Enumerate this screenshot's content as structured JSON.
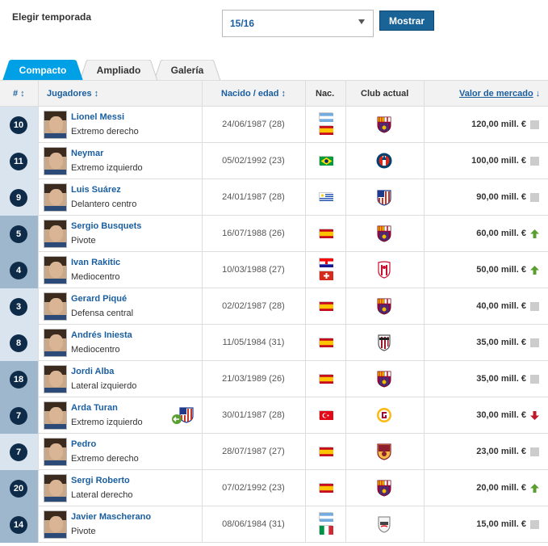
{
  "season": {
    "label": "Elegir temporada",
    "selected": "15/16",
    "button": "Mostrar"
  },
  "tabs": [
    {
      "label": "Compacto",
      "active": true
    },
    {
      "label": "Ampliado",
      "active": false
    },
    {
      "label": "Galería",
      "active": false
    }
  ],
  "header": {
    "num": "#",
    "players": "Jugadores",
    "born": "Nacido / edad",
    "nat": "Nac.",
    "club": "Club actual",
    "value": "Valor de mercado"
  },
  "rows": [
    {
      "num": "10",
      "name": "Lionel Messi",
      "position": "Extremo derecho",
      "born": "24/06/1987 (28)",
      "flags": [
        "argentina",
        "spain"
      ],
      "club": "barcelona",
      "value": "120,00 mill. €",
      "trend": "same"
    },
    {
      "num": "11",
      "name": "Neymar",
      "position": "Extremo izquierdo",
      "born": "05/02/1992 (23)",
      "flags": [
        "brazil"
      ],
      "club": "psg",
      "value": "100,00 mill. €",
      "trend": "same"
    },
    {
      "num": "9",
      "name": "Luis Suárez",
      "position": "Delantero centro",
      "born": "24/01/1987 (28)",
      "flags": [
        "uruguay"
      ],
      "club": "atletico",
      "value": "90,00 mill. €",
      "trend": "same"
    },
    {
      "num": "5",
      "name": "Sergio Busquets",
      "position": "Pivote",
      "born": "16/07/1988 (26)",
      "flags": [
        "spain"
      ],
      "club": "barcelona",
      "value": "60,00 mill. €",
      "trend": "up"
    },
    {
      "num": "4",
      "name": "Ivan Rakitic",
      "position": "Mediocentro",
      "born": "10/03/1988 (27)",
      "flags": [
        "croatia",
        "switzerland"
      ],
      "club": "sevilla",
      "value": "50,00 mill. €",
      "trend": "up"
    },
    {
      "num": "3",
      "name": "Gerard Piqué",
      "position": "Defensa central",
      "born": "02/02/1987 (28)",
      "flags": [
        "spain"
      ],
      "club": "barcelona",
      "value": "40,00 mill. €",
      "trend": "same"
    },
    {
      "num": "8",
      "name": "Andrés Iniesta",
      "position": "Mediocentro",
      "born": "11/05/1984 (31)",
      "flags": [
        "spain"
      ],
      "club": "vissel",
      "value": "35,00 mill. €",
      "trend": "same"
    },
    {
      "num": "18",
      "name": "Jordi Alba",
      "position": "Lateral izquierdo",
      "born": "21/03/1989 (26)",
      "flags": [
        "spain"
      ],
      "club": "barcelona",
      "value": "35,00 mill. €",
      "trend": "same"
    },
    {
      "num": "7",
      "name": "Arda Turan",
      "position": "Extremo izquierdo",
      "born": "30/01/1987 (28)",
      "flags": [
        "turkey"
      ],
      "club": "galatasaray",
      "value": "30,00 mill. €",
      "trend": "down",
      "transfer": true
    },
    {
      "num": "7",
      "name": "Pedro",
      "position": "Extremo derecho",
      "born": "28/07/1987 (27)",
      "flags": [
        "spain"
      ],
      "club": "roma",
      "value": "23,00 mill. €",
      "trend": "same"
    },
    {
      "num": "20",
      "name": "Sergi Roberto",
      "position": "Lateral derecho",
      "born": "07/02/1992 (23)",
      "flags": [
        "spain"
      ],
      "club": "barcelona",
      "value": "20,00 mill. €",
      "trend": "up"
    },
    {
      "num": "14",
      "name": "Javier Mascherano",
      "position": "Pivote",
      "born": "08/06/1984 (31)",
      "flags": [
        "argentina",
        "italy"
      ],
      "club": "estudiantes",
      "value": "15,00 mill. €",
      "trend": "same"
    }
  ],
  "colors": {
    "accent": "#1a5e9f",
    "tab_active": "#00a0e6",
    "badge": "#0e2c4a",
    "up": "#5a9e2f",
    "down": "#c0182a"
  }
}
